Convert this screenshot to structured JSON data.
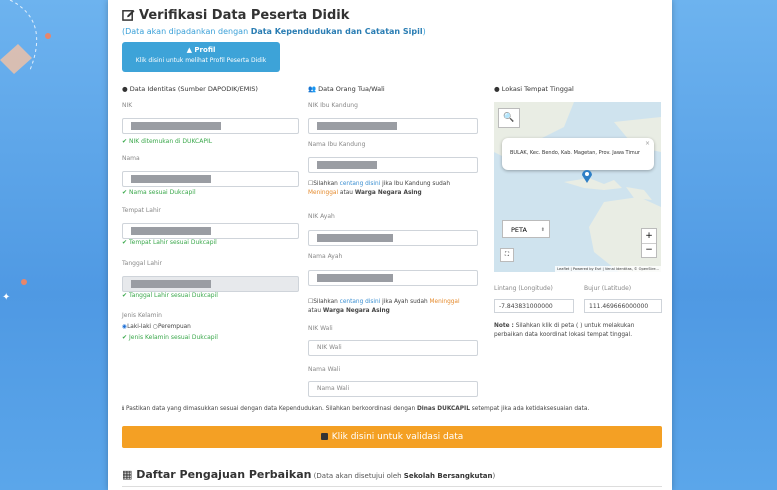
{
  "page": {
    "title": "Verifikasi Data Peserta Didik",
    "subtitle_prefix": "(Data akan dipadankan dengan ",
    "subtitle_bold": "Data Kependudukan dan Catatan Sipil",
    "subtitle_suffix": ")"
  },
  "profil_button": {
    "title": "Profil",
    "caption": "Klik disini untuk melihat Profil Peserta Didik"
  },
  "identitas": {
    "heading": "Data Identitas",
    "heading_source": "(Sumber DAPODIK/EMIS)",
    "nik_label": "NIK",
    "nik_ok": "NIK ditemukan di DUKCAPIL",
    "nama_label": "Nama",
    "nama_ok": "Nama sesuai Dukcapil",
    "tempat_label": "Tempat Lahir",
    "tempat_ok": "Tempat Lahir sesuai Dukcapil",
    "tanggal_label": "Tanggal Lahir",
    "tanggal_ok": "Tanggal Lahir sesuai Dukcapil",
    "jk_label": "Jenis Kelamin",
    "jk_male": "Laki-laki",
    "jk_female": "Perempuan",
    "jk_ok": "Jenis Kelamin sesuai Dukcapil"
  },
  "ortu": {
    "heading": "Data Orang Tua/Wali",
    "nik_ibu_label": "NIK Ibu Kandung",
    "nama_ibu_label": "Nama Ibu Kandung",
    "ibu_note_1": "Silahkan ",
    "ibu_note_link": "centang disini",
    "ibu_note_2": " jika Ibu Kandung sudah",
    "ibu_note_3": "Meninggal",
    "ibu_note_4": " atau ",
    "ibu_note_5": "Warga Negara Asing",
    "nik_ayah_label": "NIK Ayah",
    "nama_ayah_label": "Nama Ayah",
    "ayah_note_1": "Silahkan ",
    "ayah_note_link": "centang disini",
    "ayah_note_2": " jika Ayah sudah ",
    "ayah_note_3": "Meninggal",
    "ayah_note_4": "atau ",
    "ayah_note_5": "Warga Negara Asing",
    "nik_wali_label": "NIK Wali",
    "nik_wali_placeholder": "NIK Wali",
    "nama_wali_label": "Nama Wali",
    "nama_wali_placeholder": "Nama Wali"
  },
  "lokasi": {
    "heading": "Lokasi Tempat Tinggal",
    "popup": "BULAK, Kec. Bendo, Kab. Magetan, Prov. Jawa Timur",
    "layer_select": "PETA",
    "zoom_in": "+",
    "zoom_out": "−",
    "attribution": "Leaflet | Powered by Esri | Venal Identitas, © OpenStre...",
    "lintang_label": "Lintang (Longitude)",
    "bujur_label": "Bujur (Latitude)",
    "lintang_value": "-7.843831000000",
    "bujur_value": "111.469666000000",
    "note_prefix": "Note :",
    "note_text": " Silahkan klik di peta ( ) untuk melakukan perbaikan data koordinat lokasi tempat tinggal."
  },
  "footer_note": {
    "text_1": "Pastikan data yang dimasukkan sesuai dengan data Kependudukan. Silahkan berkoordinasi dengan ",
    "bold": "Dinas DUKCAPIL",
    "text_2": " setempat jika ada ketidaksesuaian data."
  },
  "validate_button": "Klik disini untuk validasi data",
  "bottom": {
    "title": "Daftar Pengajuan Perbaikan",
    "sub_1": " (Data akan disetujui oleh ",
    "sub_bold": "Sekolah Bersangkutan",
    "sub_2": ")"
  },
  "colors": {
    "accent_blue": "#3da3d8",
    "ok_green": "#3aa84b",
    "validate_orange": "#f4a024",
    "background": "#5aa2e8"
  }
}
